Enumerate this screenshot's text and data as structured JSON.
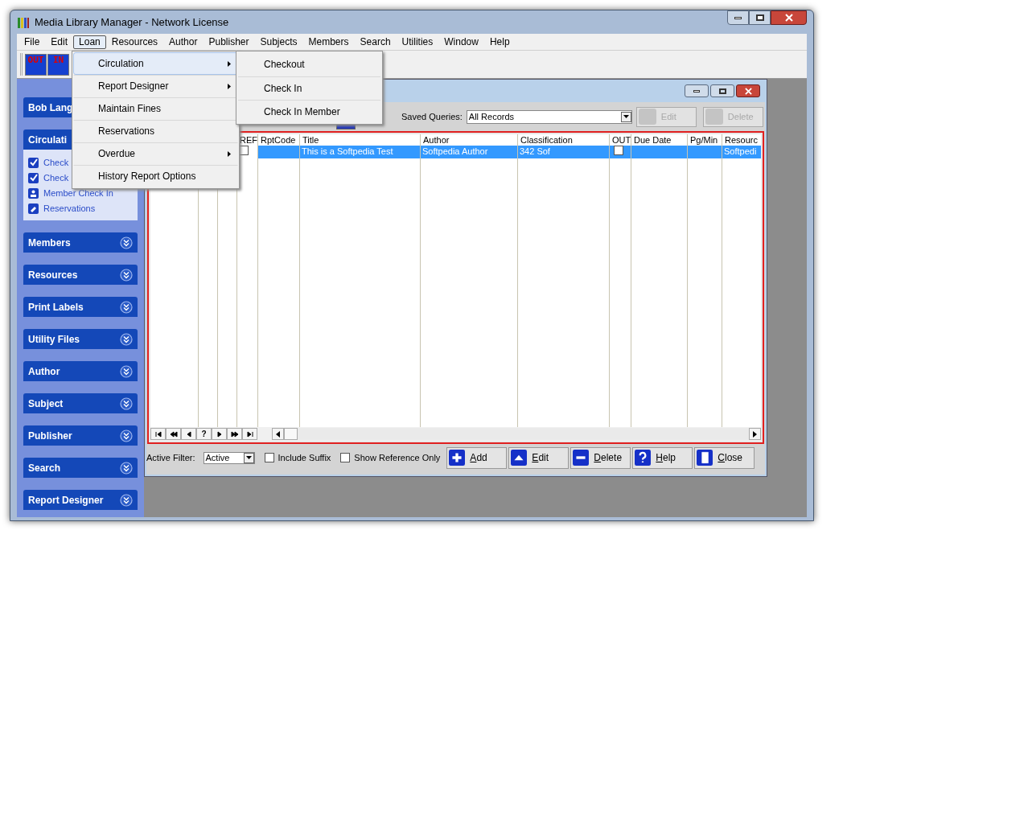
{
  "window": {
    "title": "Media Library Manager - Network License"
  },
  "menu_bar": [
    {
      "label": "File",
      "selected": false
    },
    {
      "label": "Edit",
      "selected": false
    },
    {
      "label": "Loan",
      "selected": true
    },
    {
      "label": "Resources",
      "selected": false
    },
    {
      "label": "Author",
      "selected": false
    },
    {
      "label": "Publisher",
      "selected": false
    },
    {
      "label": "Subjects",
      "selected": false
    },
    {
      "label": "Members",
      "selected": false
    },
    {
      "label": "Search",
      "selected": false
    },
    {
      "label": "Utilities",
      "selected": false
    },
    {
      "label": "Window",
      "selected": false
    },
    {
      "label": "Help",
      "selected": false
    }
  ],
  "toolbar": [
    {
      "label": "OUT"
    },
    {
      "label": "IN"
    }
  ],
  "loan_menu": [
    {
      "label": "Circulation",
      "submenu": true,
      "selected": true
    },
    {
      "label": "Report Designer",
      "submenu": true,
      "selected": false
    },
    {
      "label": "Maintain Fines",
      "submenu": false,
      "selected": false
    },
    {
      "label": "Reservations",
      "submenu": false,
      "selected": false
    },
    {
      "label": "Overdue",
      "submenu": true,
      "selected": false
    },
    {
      "label": "History Report Options",
      "submenu": false,
      "selected": false
    }
  ],
  "circulation_submenu": [
    "Checkout",
    "Check In",
    "Check In Member"
  ],
  "sidebar": {
    "user": "Bob Lang",
    "panel": {
      "title": "Circulati",
      "items": [
        {
          "label": "Check",
          "kind": "check"
        },
        {
          "label": "Check",
          "kind": "check"
        },
        {
          "label": "Member Check In",
          "kind": "member"
        },
        {
          "label": "Reservations",
          "kind": "reserve"
        }
      ]
    },
    "sections": [
      "Members",
      "Resources",
      "Print Labels",
      "Utility Files",
      "Author",
      "Subject",
      "Publisher",
      "Search",
      "Report Designer"
    ]
  },
  "child": {
    "saved_queries_label": "Saved Queries:",
    "saved_query": "All Records",
    "edit": "Edit",
    "delete": "Delete",
    "columns": [
      "REF",
      "RptCode",
      "Title",
      "Author",
      "Classification",
      "OUT",
      "Due Date",
      "Pg/Min",
      "Resourc"
    ],
    "rows": [
      {
        "selected": true,
        "ref": false,
        "out": false,
        "title": "This is a Softpedia Test",
        "author": "Softpedia Author",
        "classification": "342 Sof",
        "resource": "Softpedi"
      }
    ],
    "navigator": [
      {
        "kind": "first"
      },
      {
        "kind": "prev-page"
      },
      {
        "kind": "prev"
      },
      {
        "kind": "find",
        "label": "?"
      },
      {
        "kind": "next"
      },
      {
        "kind": "next-page"
      },
      {
        "kind": "last"
      }
    ],
    "active_filter_label": "Active Filter:",
    "active_filter": "Active",
    "options": [
      {
        "label": "Include Suffix",
        "checked": false
      },
      {
        "label": "Show Reference Only",
        "checked": false
      }
    ],
    "buttons": [
      {
        "label": "Add",
        "kind": "add"
      },
      {
        "label": "Edit",
        "kind": "edit"
      },
      {
        "label": "Delete",
        "kind": "delete"
      },
      {
        "label": "Help",
        "kind": "help"
      },
      {
        "label": "Close",
        "kind": "close"
      }
    ]
  }
}
